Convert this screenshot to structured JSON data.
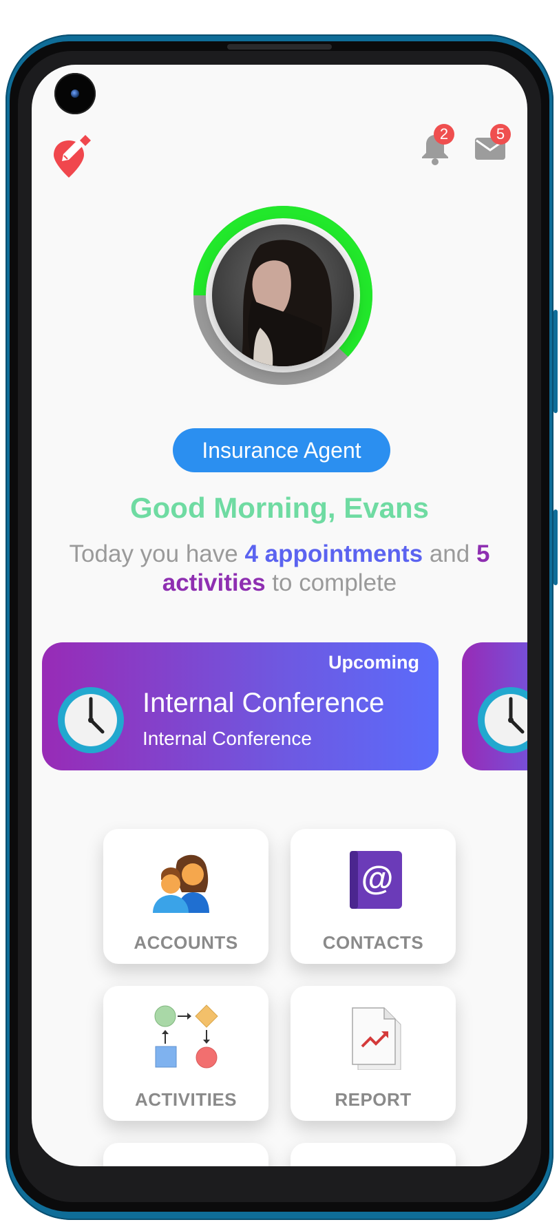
{
  "header": {
    "logo_icon": "map-pin-edit-icon",
    "notifications": {
      "icon": "bell-icon",
      "count": "2"
    },
    "messages": {
      "icon": "mail-icon",
      "count": "5"
    }
  },
  "profile": {
    "progress_fraction": 0.62,
    "role": "Insurance Agent",
    "greeting": "Good Morning, Evans"
  },
  "summary": {
    "prefix": "Today you have",
    "appointments": "4 appointments",
    "middle": "and",
    "activities": "5 activities",
    "suffix": "to complete"
  },
  "events": [
    {
      "status": "Upcoming",
      "title": "Internal Conference",
      "subtitle": "Internal Conference",
      "icon": "clock-icon"
    },
    {
      "status": "",
      "title": "",
      "subtitle": "",
      "icon": "clock-icon"
    }
  ],
  "menu": [
    {
      "label": "ACCOUNTS",
      "icon": "people-icon"
    },
    {
      "label": "CONTACTS",
      "icon": "address-book-icon"
    },
    {
      "label": "ACTIVITIES",
      "icon": "flowchart-icon"
    },
    {
      "label": "REPORT",
      "icon": "report-chart-icon"
    },
    {
      "label": "",
      "icon": "calendar-icon"
    },
    {
      "label": "",
      "icon": "bar-chart-icon"
    }
  ],
  "colors": {
    "accent_green": "#6fdba2",
    "ring_green": "#22e82b",
    "ring_gray": "#9a9a9a",
    "role_blue": "#2b8ff0",
    "appt_blue": "#5b63f0",
    "activity_purple": "#8e2fb1",
    "badge_red": "#ef4f4f"
  }
}
